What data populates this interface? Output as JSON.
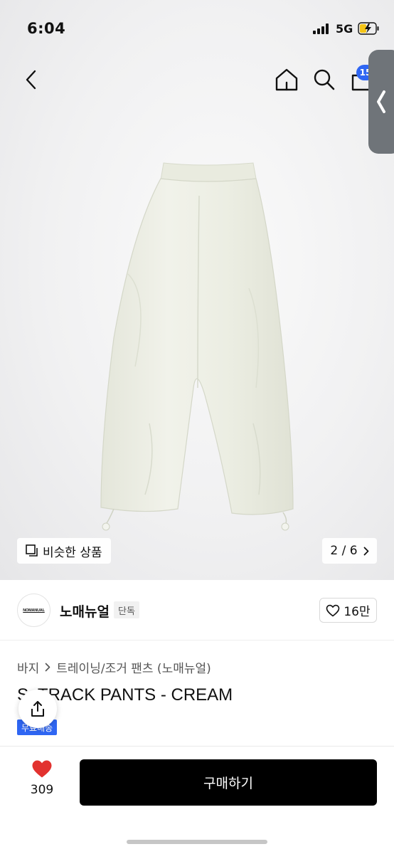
{
  "status_bar": {
    "time": "6:04",
    "network": "5G"
  },
  "header": {
    "cart_count": "15"
  },
  "gallery": {
    "similar_label": "비슷한 상품",
    "page_current": "2",
    "page_separator": "/",
    "page_total": "6"
  },
  "brand": {
    "logo_text": "NOMANUAL",
    "name": "노매뉴얼",
    "badge": "단독",
    "likes": "16만"
  },
  "product": {
    "breadcrumb": [
      "바지",
      "트레이닝/조거 팬츠 (노매뉴얼)"
    ],
    "title": "S. TRACK PANTS - CREAM",
    "badge": "무료배송"
  },
  "bottom_bar": {
    "heart_count": "309",
    "buy_label": "구매하기"
  },
  "colors": {
    "accent": "#2f66f3",
    "buy_button": "#000000",
    "heart": "#e2322f",
    "product_fabric": "#eceee3"
  }
}
